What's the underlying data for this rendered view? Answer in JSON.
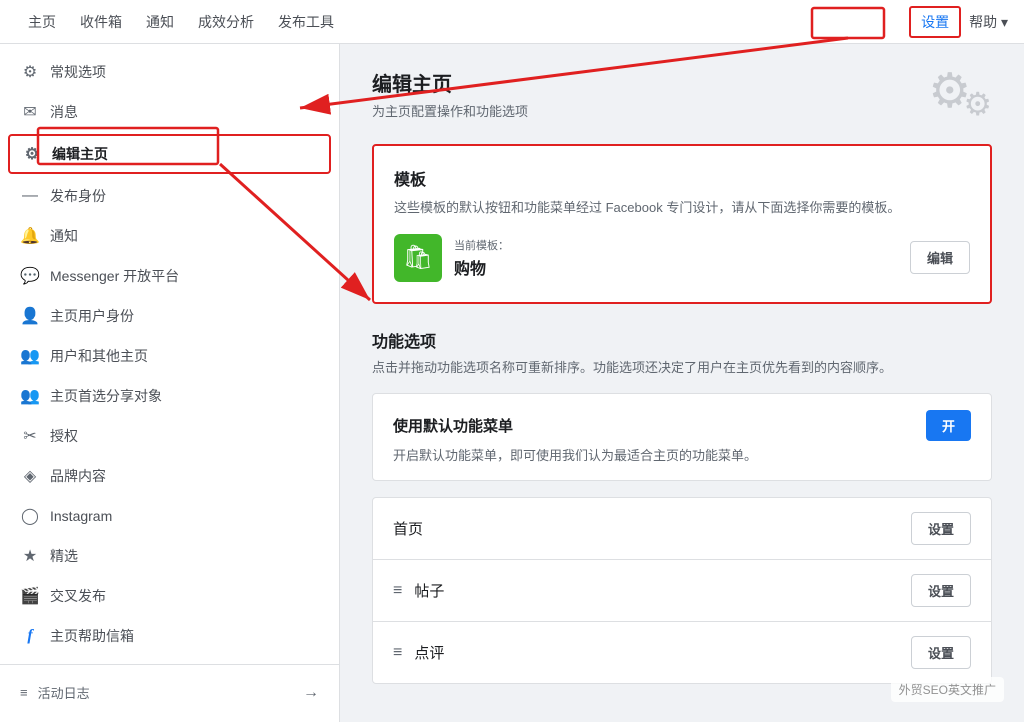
{
  "topNav": {
    "items": [
      "主页",
      "收件箱",
      "通知",
      "成效分析",
      "发布工具"
    ],
    "settings": "设置",
    "help": "帮助 ▾"
  },
  "sidebar": {
    "items": [
      {
        "id": "general",
        "icon": "⚙",
        "label": "常规选项"
      },
      {
        "id": "messages",
        "icon": "✉",
        "label": "消息"
      },
      {
        "id": "edit-page",
        "icon": "⚙",
        "label": "编辑主页",
        "active": true
      },
      {
        "id": "publish-identity",
        "icon": "—",
        "label": "发布身份"
      },
      {
        "id": "notifications",
        "icon": "🔔",
        "label": "通知"
      },
      {
        "id": "messenger",
        "icon": "💬",
        "label": "Messenger 开放平台"
      },
      {
        "id": "page-roles",
        "icon": "👤",
        "label": "主页用户身份"
      },
      {
        "id": "other-pages",
        "icon": "👥",
        "label": "用户和其他主页"
      },
      {
        "id": "featured",
        "icon": "👥",
        "label": "主页首选分享对象"
      },
      {
        "id": "permissions",
        "icon": "✂",
        "label": "授权"
      },
      {
        "id": "brand-content",
        "icon": "◈",
        "label": "品牌内容"
      },
      {
        "id": "instagram",
        "icon": "◯",
        "label": "Instagram"
      },
      {
        "id": "featured-items",
        "icon": "★",
        "label": "精选"
      },
      {
        "id": "crosspost",
        "icon": "🎬",
        "label": "交叉发布"
      },
      {
        "id": "page-support",
        "icon": "f",
        "label": "主页帮助信箱"
      }
    ],
    "footer": {
      "icon": "≡",
      "label": "活动日志",
      "arrowIcon": "→"
    }
  },
  "mainContent": {
    "pageTitle": "编辑主页",
    "pageSubtitle": "为主页配置操作和功能选项",
    "templateCard": {
      "title": "模板",
      "desc": "这些模板的默认按钮和功能菜单经过 Facebook 专门设计，请从下面选择你需要的模板。",
      "currentLabel": "当前模板：",
      "currentName": "购物",
      "editBtn": "编辑"
    },
    "featuresSection": {
      "title": "功能选项",
      "desc": "点击并拖动功能选项名称可重新排序。功能选项还决定了用户在主页优先看到的内容顺序。"
    },
    "defaultMenu": {
      "title": "使用默认功能菜单",
      "desc": "开启默认功能菜单，即可使用我们认为最适合主页的功能菜单。",
      "toggleLabel": "开"
    },
    "menuItems": [
      {
        "label": "首页",
        "btnLabel": "设置"
      },
      {
        "label": "帖子",
        "btnLabel": "设置",
        "hasDrag": true
      },
      {
        "label": "点评",
        "btnLabel": "设置",
        "hasDrag": true
      }
    ]
  },
  "watermark": "外贸SEO英文推广"
}
